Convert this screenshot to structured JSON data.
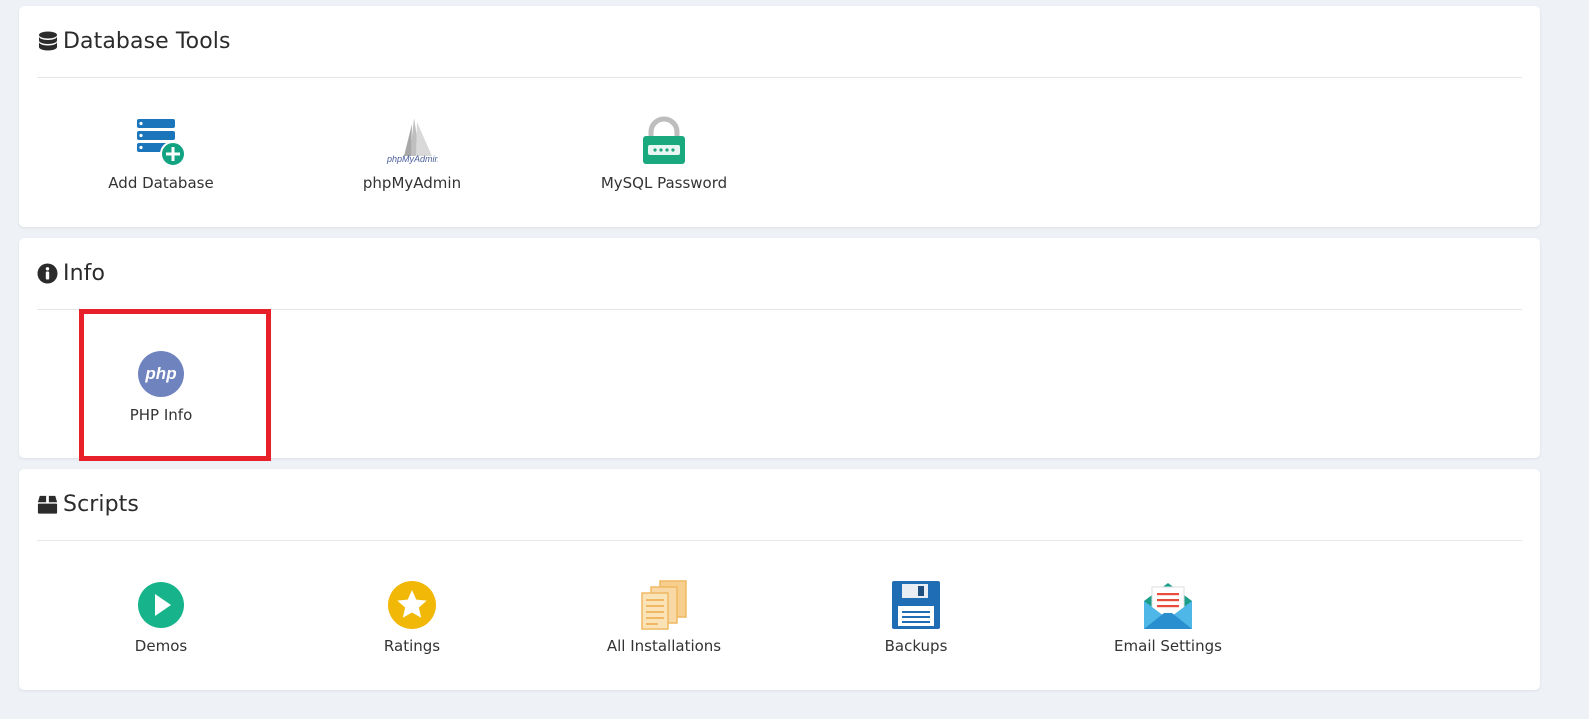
{
  "sections": {
    "database_tools": {
      "title": "Database Tools",
      "icon": "database-icon",
      "items": [
        {
          "label": "Add Database",
          "icon": "add-database-icon"
        },
        {
          "label": "phpMyAdmin",
          "icon": "phpmyadmin-icon"
        },
        {
          "label": "MySQL Password",
          "icon": "mysql-password-icon"
        }
      ]
    },
    "info": {
      "title": "Info",
      "icon": "info-circle-icon",
      "items": [
        {
          "label": "PHP Info",
          "icon": "php-icon"
        }
      ]
    },
    "scripts": {
      "title": "Scripts",
      "icon": "box-icon",
      "items": [
        {
          "label": "Demos",
          "icon": "play-circle-icon"
        },
        {
          "label": "Ratings",
          "icon": "star-circle-icon"
        },
        {
          "label": "All Installations",
          "icon": "documents-icon"
        },
        {
          "label": "Backups",
          "icon": "floppy-disk-icon"
        },
        {
          "label": "Email Settings",
          "icon": "envelope-letter-icon"
        }
      ]
    }
  },
  "php_logo_text": "php",
  "phpmyadmin_logo_text": "phpMyAdmin",
  "colors": {
    "highlight": "#e8202a",
    "add_db_blue": "#1b75bb",
    "add_db_green": "#12a383",
    "mysql_green": "#1aa97f",
    "php_purple": "#6f84bf",
    "demos_green": "#17b48c",
    "ratings_yellow": "#f2b807",
    "installations_orange": "#f0b862",
    "backups_blue": "#1f6db5",
    "email_teal": "#1a9e8a"
  }
}
